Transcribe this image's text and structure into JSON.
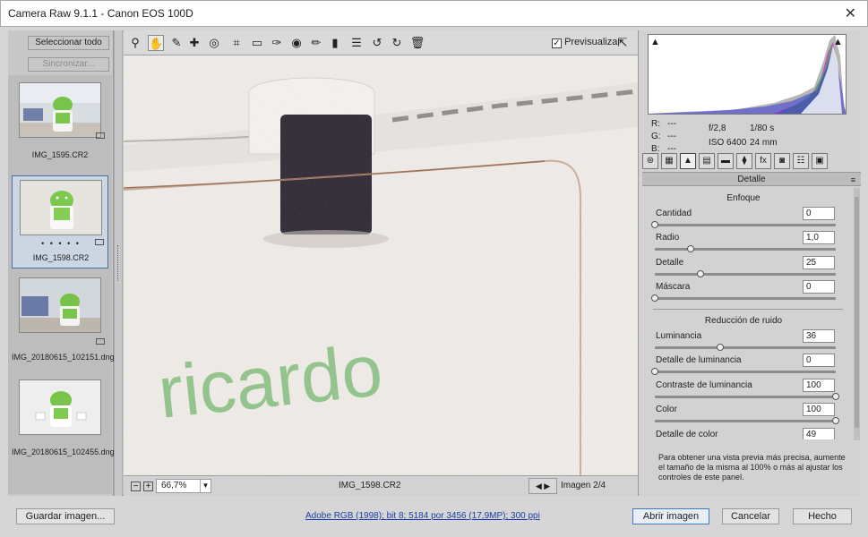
{
  "window": {
    "title": "Camera Raw 9.1.1 -  Canon EOS 100D",
    "close_glyph": "✕"
  },
  "filmstrip": {
    "select_all": "Seleccionar todo",
    "sync": "Sincronizar...",
    "items": [
      {
        "name": "IMG_1595.CR2",
        "selected": false,
        "stars": ""
      },
      {
        "name": "IMG_1598.CR2",
        "selected": true,
        "stars": "• • • • •"
      },
      {
        "name": "IMG_20180615_102151.dng",
        "selected": false,
        "stars": ""
      },
      {
        "name": "IMG_20180615_102455.dng",
        "selected": false,
        "stars": ""
      }
    ]
  },
  "toolbar": {
    "tools": [
      {
        "icon": "zoom-icon",
        "glyph": "⚲"
      },
      {
        "icon": "hand-icon",
        "glyph": "✋",
        "active": true
      },
      {
        "icon": "white-balance-icon",
        "glyph": "✎"
      },
      {
        "icon": "color-sampler-icon",
        "glyph": "✚"
      },
      {
        "icon": "targeted-adjustment-icon",
        "glyph": "◎"
      },
      {
        "icon": "crop-icon",
        "glyph": "⌗"
      },
      {
        "icon": "straighten-icon",
        "glyph": "▭"
      },
      {
        "icon": "spot-removal-icon",
        "glyph": "✑"
      },
      {
        "icon": "red-eye-icon",
        "glyph": "◉"
      },
      {
        "icon": "adjustment-brush-icon",
        "glyph": "✏"
      },
      {
        "icon": "graduated-filter-icon",
        "glyph": "▮"
      },
      {
        "icon": "preferences-icon",
        "glyph": "☰"
      },
      {
        "icon": "rotate-left-icon",
        "glyph": "↺"
      },
      {
        "icon": "rotate-right-icon",
        "glyph": "↻"
      },
      {
        "icon": "trash-icon",
        "glyph": "🗑"
      }
    ],
    "preview_label": "Previsualizar",
    "preview_checked": true,
    "fullscreen_glyph": "⇱"
  },
  "canvas": {
    "image_text": "ricardo"
  },
  "status": {
    "zoom_out": "−",
    "zoom_in": "+",
    "zoom": "66,7%",
    "filename": "IMG_1598.CR2",
    "nav": "◀ ▶",
    "count": "Imagen 2/4"
  },
  "histogram": {
    "readout": {
      "r_label": "R:",
      "g_label": "G:",
      "b_label": "B:",
      "r": "---",
      "g": "---",
      "b": "---"
    },
    "exif": {
      "aperture": "f/2,8",
      "shutter": "1/80 s",
      "iso": "ISO 6400",
      "focal": "24 mm"
    }
  },
  "tabs": [
    "⊛",
    "▦",
    "▲",
    "▤",
    "▬",
    "⧫",
    "fx",
    "◙",
    "☷",
    "▣"
  ],
  "panel": {
    "title": "Detalle",
    "menu_glyph": "≡",
    "sharpen_title": "Enfoque",
    "noise_title": "Reducción de ruido",
    "sliders": {
      "cantidad": {
        "label": "Cantidad",
        "value": "0",
        "fraction": 0.0
      },
      "radio": {
        "label": "Radio",
        "value": "1,0",
        "fraction": 0.2
      },
      "detalle": {
        "label": "Detalle",
        "value": "25",
        "fraction": 0.25
      },
      "mascara": {
        "label": "Máscara",
        "value": "0",
        "fraction": 0.0
      },
      "luminancia": {
        "label": "Luminancia",
        "value": "36",
        "fraction": 0.36
      },
      "detalle_lum": {
        "label": "Detalle de luminancia",
        "value": "0",
        "fraction": 0.0
      },
      "contraste_lum": {
        "label": "Contraste de luminancia",
        "value": "100",
        "fraction": 1.0
      },
      "color": {
        "label": "Color",
        "value": "100",
        "fraction": 1.0
      },
      "detalle_color": {
        "label": "Detalle de color",
        "value": "49",
        "fraction": 0.49
      }
    },
    "hint": "Para obtener una vista previa más precisa, aumente el tamaño de la misma al 100% o más al ajustar los controles de este panel."
  },
  "footer": {
    "save": "Guardar imagen...",
    "workflow": "Adobe RGB (1998); bit 8; 5184 por 3456 (17,9MP); 300 ppi",
    "open": "Abrir imagen",
    "cancel": "Cancelar",
    "done": "Hecho"
  }
}
